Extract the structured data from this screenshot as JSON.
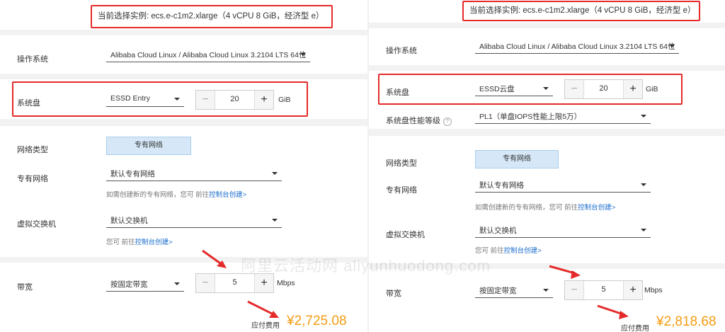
{
  "left": {
    "current_instance": "当前选择实例: ecs.e-c1m2.xlarge（4 vCPU 8 GiB，经济型 e）",
    "os": {
      "label": "操作系统",
      "value": "Alibaba Cloud Linux / Alibaba Cloud Linux 3.2104 LTS 64位"
    },
    "disk": {
      "label": "系统盘",
      "type": "ESSD Entry",
      "size": "20",
      "unit": "GiB"
    },
    "network_type": {
      "label": "网络类型",
      "button": "专有网络"
    },
    "vpc": {
      "label": "专有网络",
      "value": "默认专有网络",
      "help_prefix": "如需创建新的专有网络，您可 前往",
      "help_link": "控制台创建>"
    },
    "vswitch": {
      "label": "虚拟交换机",
      "value": "默认交换机",
      "help_prefix": "您可 前往",
      "help_link": "控制台创建>"
    },
    "bandwidth": {
      "label": "带宽",
      "mode": "按固定带宽",
      "value": "5",
      "unit": "Mbps"
    },
    "price": {
      "label": "应付费用",
      "value": "¥2,725.08"
    }
  },
  "right": {
    "current_instance": "当前选择实例: ecs.e-c1m2.xlarge（4 vCPU 8 GiB，经济型 e）",
    "os": {
      "label": "操作系统",
      "value": "Alibaba Cloud Linux / Alibaba Cloud Linux 3.2104 LTS 64位"
    },
    "disk": {
      "label": "系统盘",
      "type": "ESSD云盘",
      "size": "20",
      "unit": "GiB"
    },
    "disk_perf": {
      "label": "系统盘性能等级",
      "value": "PL1（单盘IOPS性能上限5万）"
    },
    "network_type": {
      "label": "网络类型",
      "button": "专有网络"
    },
    "vpc": {
      "label": "专有网络",
      "value": "默认专有网络",
      "help_prefix": "如需创建新的专有网络，您可 前往",
      "help_link": "控制台创建>"
    },
    "vswitch": {
      "label": "虚拟交换机",
      "value": "默认交换机",
      "help_prefix": "您可 前往",
      "help_link": "控制台创建>"
    },
    "bandwidth": {
      "label": "带宽",
      "mode": "按固定带宽",
      "value": "5",
      "unit": "Mbps"
    },
    "price": {
      "label": "应付费用",
      "value": "¥2,818.68"
    }
  },
  "icons": {
    "minus": "−",
    "plus": "+"
  },
  "watermark": "阿里云活动网 aliyunhuodong.com",
  "colors": {
    "highlight": "#e52a2a",
    "price": "#f39c12",
    "link": "#1a6ccc",
    "network_button": "#d6e8f8"
  }
}
